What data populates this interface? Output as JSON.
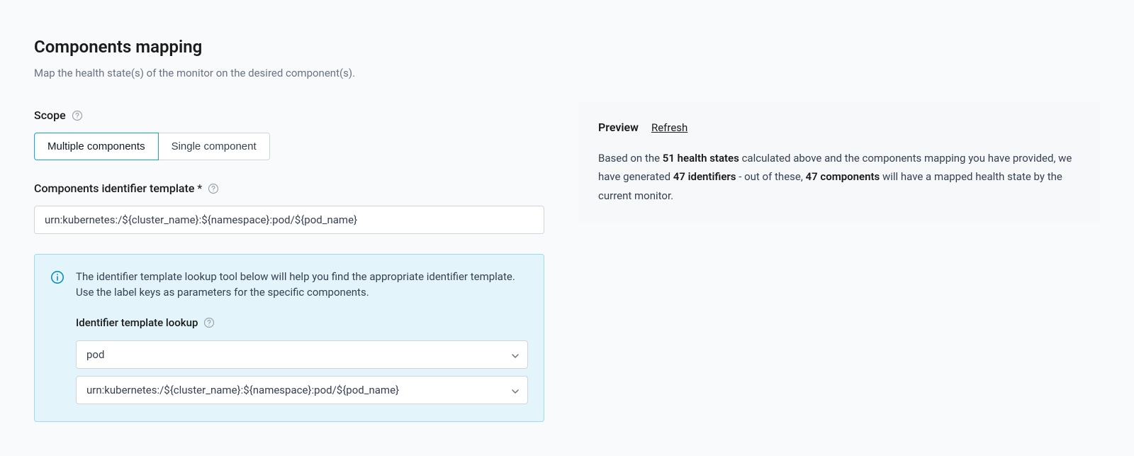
{
  "header": {
    "title": "Components mapping",
    "subtitle": "Map the health state(s) of the monitor on the desired component(s)."
  },
  "scope": {
    "label": "Scope",
    "options": [
      "Multiple components",
      "Single component"
    ],
    "active": 0
  },
  "identifier_template": {
    "label": "Components identifier template",
    "required_mark": "*",
    "value": "urn:kubernetes:/${cluster_name}:${namespace}:pod/${pod_name}"
  },
  "info_box": {
    "text": "The identifier template lookup tool below will help you find the appropriate identifier template. Use the label keys as parameters for the specific components.",
    "lookup_label": "Identifier template lookup",
    "select1_value": "pod",
    "select2_value": "urn:kubernetes:/${cluster_name}:${namespace}:pod/${pod_name}"
  },
  "preview": {
    "title": "Preview",
    "refresh": "Refresh",
    "text_pre": "Based on the ",
    "health_states": "51 health states",
    "text_mid1": " calculated above and the components mapping you have provided, we have generated ",
    "identifiers": "47 identifiers",
    "text_mid2": " - out of these, ",
    "components": "47 components",
    "text_post": " will have a mapped health state by the current monitor."
  }
}
